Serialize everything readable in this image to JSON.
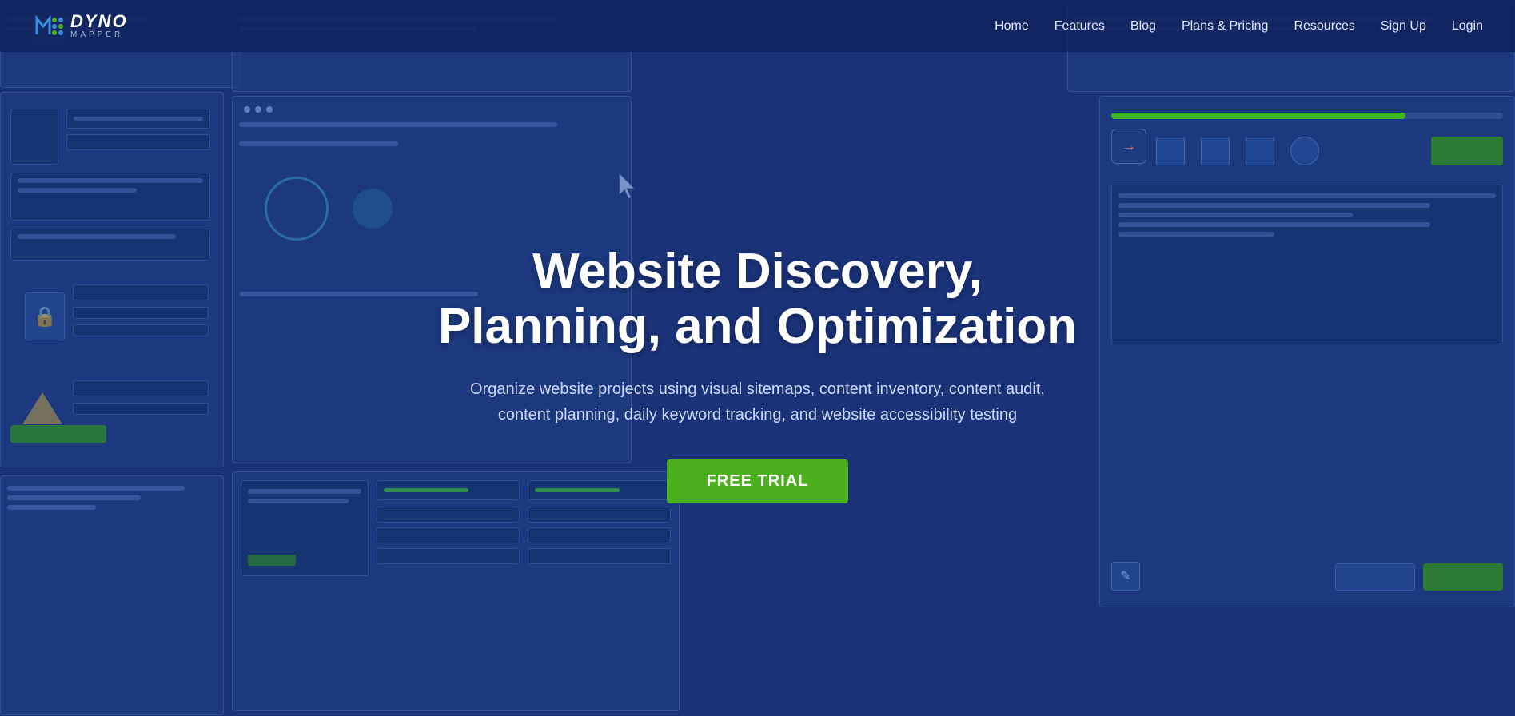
{
  "nav": {
    "logo_dyno": "DYNO",
    "logo_mapper": "MAPPER",
    "links": [
      {
        "label": "Home",
        "id": "nav-home"
      },
      {
        "label": "Features",
        "id": "nav-features"
      },
      {
        "label": "Blog",
        "id": "nav-blog"
      },
      {
        "label": "Plans & Pricing",
        "id": "nav-plans"
      },
      {
        "label": "Resources",
        "id": "nav-resources"
      },
      {
        "label": "Sign Up",
        "id": "nav-signup"
      },
      {
        "label": "Login",
        "id": "nav-login"
      }
    ]
  },
  "hero": {
    "title": "Website Discovery, Planning, and Optimization",
    "subtitle": "Organize website projects using visual sitemaps, content inventory, content audit, content planning, daily keyword tracking, and website accessibility testing",
    "cta_label": "FREE TRIAL"
  }
}
